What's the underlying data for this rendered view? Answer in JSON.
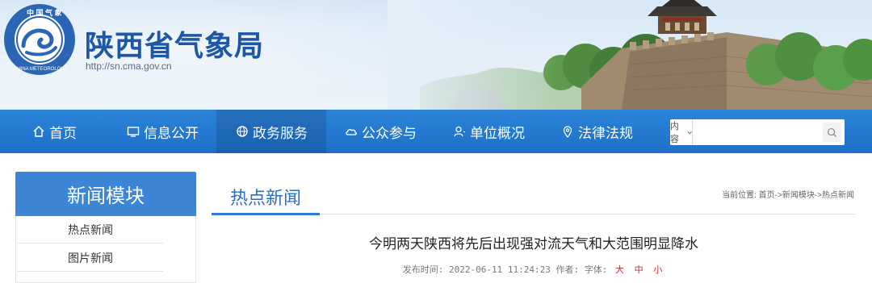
{
  "site": {
    "title": "陕西省气象局",
    "url": "http://sn.cma.gov.cn",
    "emblem_top_text": "中 国 气 象",
    "emblem_bottom_text": "CHINA METEOROLOGY"
  },
  "nav": {
    "items": [
      {
        "label": "首页",
        "icon": "home-icon"
      },
      {
        "label": "信息公开",
        "icon": "monitor-icon"
      },
      {
        "label": "政务服务",
        "icon": "globe-icon",
        "active": true
      },
      {
        "label": "公众参与",
        "icon": "cloud-icon"
      },
      {
        "label": "单位概况",
        "icon": "user-icon"
      },
      {
        "label": "法律法规",
        "icon": "location-pin-icon"
      }
    ],
    "search": {
      "select_value": "内容",
      "placeholder": ""
    }
  },
  "sidebar": {
    "title": "新闻模块",
    "items": [
      "热点新闻",
      "图片新闻"
    ]
  },
  "main": {
    "tab": "热点新闻",
    "breadcrumb": "当前位置: 首页->新闻模块->热点新闻",
    "article": {
      "title": "今明两天陕西将先后出现强对流天气和大范围明显降水",
      "meta_prefix": "发布时间: 2022-06-11 11:24:23 作者:  字体:",
      "font_sizes": [
        "大",
        "中",
        "小"
      ]
    }
  },
  "colors": {
    "brand_blue": "#1f57a8",
    "nav_blue": "#2379cf",
    "nav_active": "#1866b9",
    "accent_red": "#dd2222"
  }
}
